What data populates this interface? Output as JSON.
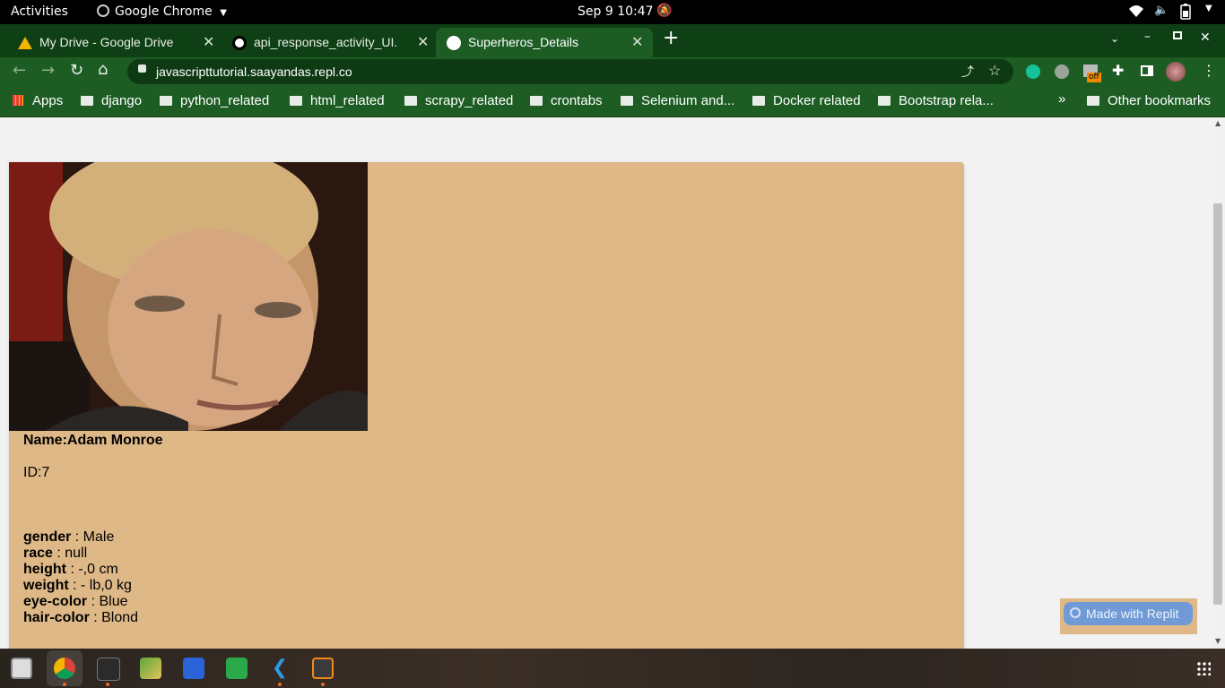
{
  "topbar": {
    "activities": "Activities",
    "app_name": "Google Chrome",
    "datetime": "Sep 9  10:47"
  },
  "tabs": [
    {
      "label": "My Drive - Google Drive",
      "active": false
    },
    {
      "label": "api_response_activity_UI.",
      "active": false
    },
    {
      "label": "Superheros_Details",
      "active": true
    }
  ],
  "toolbar": {
    "url": "javascripttutorial.saayandas.repl.co",
    "extension_badge": "off"
  },
  "bookmarks": {
    "apps": "Apps",
    "items": [
      "django",
      "python_related",
      "html_related",
      "scrapy_related",
      "crontabs",
      "Selenium and...",
      "Docker related",
      "Bootstrap rela..."
    ],
    "overflow": "»",
    "other": "Other bookmarks"
  },
  "hero": {
    "name_label": "Name:",
    "name": "Adam Monroe",
    "id_label": "ID:",
    "id": "7",
    "attributes": [
      {
        "key": "gender",
        "value": " : Male"
      },
      {
        "key": "race",
        "value": " : null"
      },
      {
        "key": "height",
        "value": " : -,0 cm"
      },
      {
        "key": "weight",
        "value": " : - lb,0 kg"
      },
      {
        "key": "eye-color",
        "value": " : Blue"
      },
      {
        "key": "hair-color",
        "value": " : Blond"
      }
    ]
  },
  "replit_badge": "Made with Replit",
  "colors": {
    "card_bg": "#deb887",
    "chrome_green": "#1d5d24",
    "replit_blue": "#6f9ad6"
  }
}
